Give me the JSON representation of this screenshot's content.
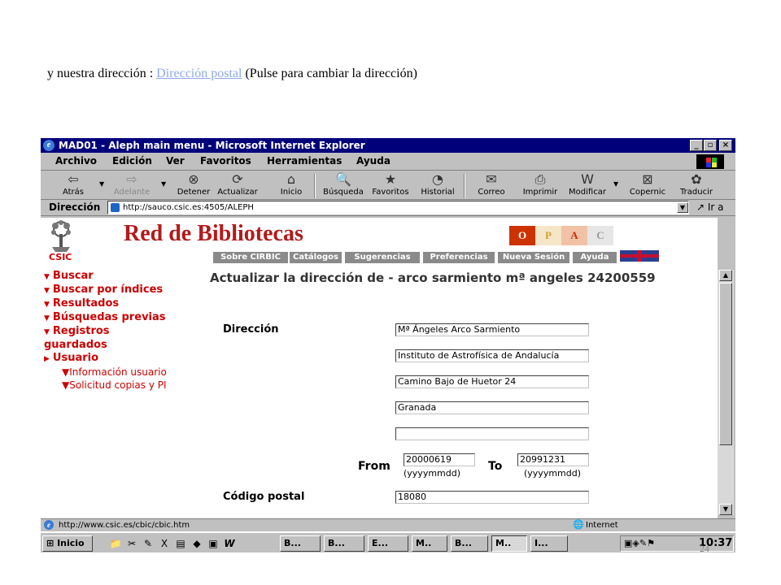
{
  "intro": {
    "prefix": "y nuestra dirección : ",
    "link": "Dirección postal",
    "suffix": " (Pulse para cambiar la dirección)"
  },
  "window": {
    "title": "MAD01 - Aleph main menu - Microsoft Internet Explorer",
    "controls": {
      "minimize": "_",
      "maximize": "▫",
      "close": "×"
    }
  },
  "menubar": [
    {
      "label": "Archivo"
    },
    {
      "label": "Edición"
    },
    {
      "label": "Ver"
    },
    {
      "label": "Favoritos"
    },
    {
      "label": "Herramientas"
    },
    {
      "label": "Ayuda"
    }
  ],
  "toolbar": [
    {
      "label": "Atrás",
      "icon": "back-arrow-icon",
      "glyph": "⇦"
    },
    {
      "label": "Adelante",
      "icon": "forward-arrow-icon",
      "glyph": "⇨"
    },
    {
      "label": "Detener",
      "icon": "stop-icon",
      "glyph": "⊗"
    },
    {
      "label": "Actualizar",
      "icon": "refresh-icon",
      "glyph": "⟳"
    },
    {
      "label": "Inicio",
      "icon": "home-icon",
      "glyph": "⌂"
    },
    {
      "label": "Búsqueda",
      "icon": "search-icon",
      "glyph": "🔍"
    },
    {
      "label": "Favoritos",
      "icon": "favorites-icon",
      "glyph": "★"
    },
    {
      "label": "Historial",
      "icon": "history-icon",
      "glyph": "◔"
    },
    {
      "label": "Correo",
      "icon": "mail-icon",
      "glyph": "✉"
    },
    {
      "label": "Imprimir",
      "icon": "print-icon",
      "glyph": "⎙"
    },
    {
      "label": "Modificar",
      "icon": "edit-icon",
      "glyph": "W"
    },
    {
      "label": "Copernic",
      "icon": "copernic-icon",
      "glyph": "⊠"
    },
    {
      "label": "Traducir",
      "icon": "translate-icon",
      "glyph": "✿"
    }
  ],
  "address": {
    "label": "Dirección",
    "url": "http://sauco.csic.es:4505/ALEPH",
    "go": "Ir a"
  },
  "site": {
    "logo_text": "CSIC",
    "title": "Red de Bibliotecas",
    "opac": [
      "O",
      "P",
      "A",
      "C"
    ],
    "nav": [
      "Sobre CIRBIC",
      "Catálogos",
      "Sugerencias",
      "Preferencias",
      "Nueva Sesión",
      "Ayuda"
    ]
  },
  "sidemenu": {
    "items": [
      "Buscar",
      "Buscar por índices",
      "Resultados",
      "Búsquedas previas",
      "Registros",
      "guardados",
      "Usuario"
    ],
    "subitems": [
      "Información usuario",
      "Solicitud copias y PI"
    ]
  },
  "form": {
    "title": "Actualizar la dirección de - arco sarmiento mª angeles 24200559",
    "direccion_label": "Dirección",
    "lines": [
      "Mª Ángeles Arco Sarmiento",
      "Instituto de Astrofísica de Andalucía",
      "Camino Bajo de Huetor 24",
      "Granada",
      ""
    ],
    "from_label": "From",
    "from_value": "20000619",
    "to_label": "To",
    "to_value": "20991231",
    "date_hint": "(yyyymmdd)",
    "postal_label": "Código postal",
    "postal_value": "18080"
  },
  "status": {
    "url": "http://www.csic.es/cbic/cbic.htm",
    "zone": "Internet"
  },
  "taskbar": {
    "start": "Inicio",
    "tasks": [
      "B...",
      "B...",
      "E...",
      "M..",
      "B...",
      "M..",
      "I..."
    ],
    "clock": "10:37"
  },
  "page_number": "24"
}
